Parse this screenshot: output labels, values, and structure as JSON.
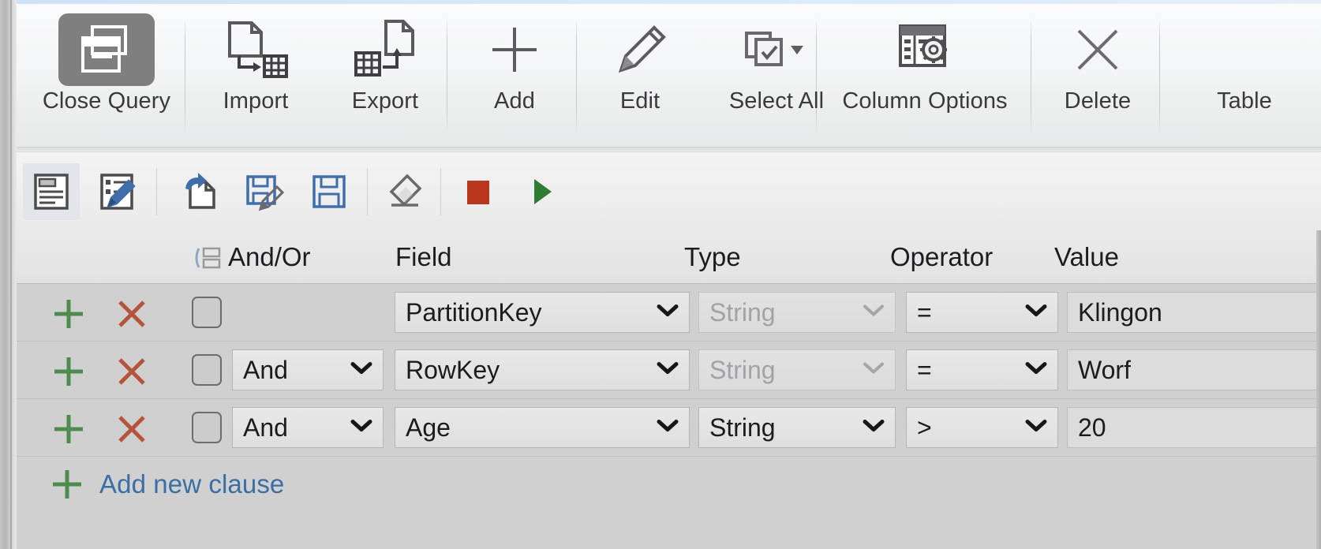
{
  "window": {
    "accent_color": "#3a6ea5",
    "selected_icon_bg": "#7f7f7f"
  },
  "ribbon": {
    "buttons": [
      {
        "label": "Close Query",
        "icon": "close-query-icon",
        "selected": true
      },
      {
        "label": "Import",
        "icon": "import-icon",
        "selected": false
      },
      {
        "label": "Export",
        "icon": "export-icon",
        "selected": false
      },
      {
        "label": "Add",
        "icon": "plus-icon",
        "selected": false
      },
      {
        "label": "Edit",
        "icon": "pencil-icon",
        "selected": false
      },
      {
        "label": "Select All",
        "icon": "select-all-icon",
        "selected": false
      },
      {
        "label": "Column Options",
        "icon": "column-options-icon",
        "selected": false
      },
      {
        "label": "Delete",
        "icon": "x-cross-icon",
        "selected": false
      },
      {
        "label": "Table",
        "icon": "table-icon",
        "selected": false
      }
    ]
  },
  "query_toolbar": {
    "buttons": [
      {
        "name": "query-text-view-button",
        "icon": "document-text-icon",
        "active": true
      },
      {
        "name": "query-edit-button",
        "icon": "document-pencil-icon",
        "active": false
      },
      {
        "name": "open-query-button",
        "icon": "open-document-icon",
        "active": false
      },
      {
        "name": "save-query-as-button",
        "icon": "save-pencil-icon",
        "active": false
      },
      {
        "name": "save-query-button",
        "icon": "floppy-disk-icon",
        "active": false
      },
      {
        "name": "clear-query-button",
        "icon": "eraser-icon",
        "active": false
      },
      {
        "name": "stop-query-button",
        "icon": "stop-square-icon",
        "active": false
      },
      {
        "name": "run-query-button",
        "icon": "play-triangle-icon",
        "active": false
      }
    ],
    "stop_color": "#b8361c",
    "run_color": "#2e7d32"
  },
  "grid": {
    "headers": {
      "group": "",
      "and_or": "And/Or",
      "field": "Field",
      "type": "Type",
      "operator": "Operator",
      "value": "Value"
    },
    "rows": [
      {
        "and_or": "",
        "and_or_enabled": false,
        "field": "PartitionKey",
        "type": "String",
        "type_enabled": false,
        "operator": "=",
        "value": "Klingon",
        "checked": false
      },
      {
        "and_or": "And",
        "and_or_enabled": true,
        "field": "RowKey",
        "type": "String",
        "type_enabled": false,
        "operator": "=",
        "value": "Worf",
        "checked": false
      },
      {
        "and_or": "And",
        "and_or_enabled": true,
        "field": "Age",
        "type": "String",
        "type_enabled": true,
        "operator": ">",
        "value": "20",
        "checked": false
      }
    ],
    "add_new_clause": "Add new clause",
    "add_row_icon": "plus-icon",
    "remove_row_icon": "x-cross-icon"
  }
}
